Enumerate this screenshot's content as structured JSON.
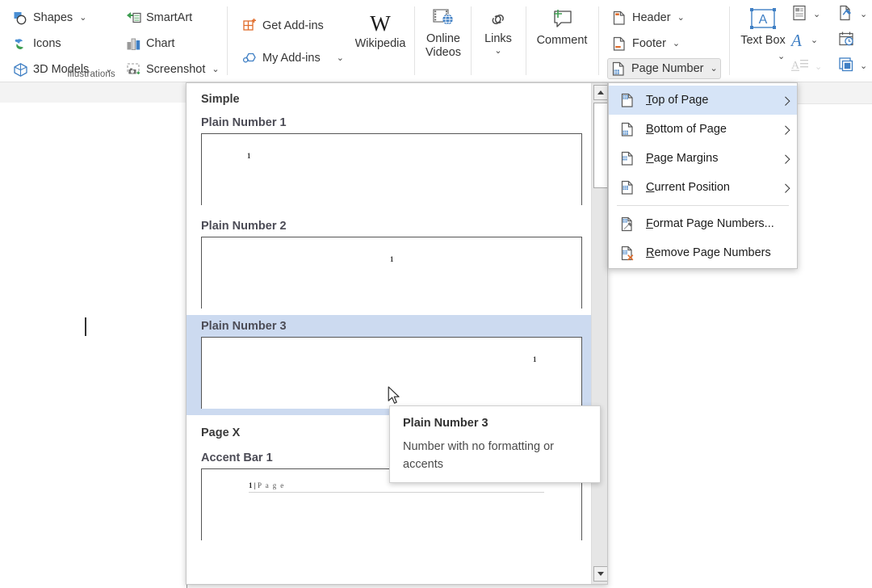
{
  "ribbon": {
    "groups": [
      {
        "name": "illustrations",
        "label": "Illustrations",
        "buttons": [
          {
            "label": "Shapes",
            "icon": "shapes-icon",
            "dropdown": true
          },
          {
            "label": "Icons",
            "icon": "icons-icon",
            "dropdown": false
          },
          {
            "label": "3D Models",
            "icon": "3d-models-icon",
            "dropdown": true
          },
          {
            "label": "SmartArt",
            "icon": "smartart-icon",
            "dropdown": false
          },
          {
            "label": "Chart",
            "icon": "chart-icon",
            "dropdown": false
          },
          {
            "label": "Screenshot",
            "icon": "screenshot-icon",
            "dropdown": true
          }
        ]
      },
      {
        "name": "add-ins",
        "buttons": [
          {
            "label": "Get Add-ins",
            "icon": "get-add-ins-icon",
            "dropdown": false
          },
          {
            "label": "My Add-ins",
            "icon": "my-add-ins-icon",
            "dropdown": true
          }
        ],
        "big": [
          {
            "label": "Wikipedia",
            "icon": "wikipedia-icon"
          }
        ]
      },
      {
        "name": "media",
        "big": [
          {
            "label": "Online Videos",
            "icon": "online-videos-icon"
          }
        ]
      },
      {
        "name": "links",
        "big": [
          {
            "label": "Links",
            "icon": "links-icon",
            "dropdown": true
          }
        ]
      },
      {
        "name": "comments",
        "big": [
          {
            "label": "Comment",
            "icon": "comment-icon"
          }
        ]
      },
      {
        "name": "header-footer",
        "buttons": [
          {
            "label": "Header",
            "icon": "header-icon",
            "dropdown": true
          },
          {
            "label": "Footer",
            "icon": "footer-icon",
            "dropdown": true
          },
          {
            "label": "Page Number",
            "icon": "page-number-icon",
            "dropdown": true,
            "state": "open"
          }
        ]
      },
      {
        "name": "text",
        "label_partial": "ext",
        "big": [
          {
            "label": "Text Box",
            "icon": "text-box-icon",
            "dropdown": true
          }
        ],
        "small_icons": [
          {
            "name": "quick-parts-icon",
            "dropdown": true
          },
          {
            "name": "wordart-icon",
            "dropdown": true
          },
          {
            "name": "drop-cap-icon",
            "dropdown": true,
            "disabled": true
          },
          {
            "name": "signature-line-icon",
            "dropdown": true
          },
          {
            "name": "date-time-icon",
            "dropdown": false
          },
          {
            "name": "object-icon",
            "dropdown": true
          }
        ]
      }
    ]
  },
  "gallery": {
    "name": "page-number-gallery",
    "categories": [
      {
        "heading": "Simple",
        "items": [
          {
            "title": "Plain Number 1",
            "number": "1",
            "align": "left",
            "selected": false
          },
          {
            "title": "Plain Number 2",
            "number": "1",
            "align": "center",
            "selected": false
          },
          {
            "title": "Plain Number 3",
            "number": "1",
            "align": "right",
            "selected": true
          }
        ]
      },
      {
        "heading": "Page X",
        "items": [
          {
            "title": "Accent Bar 1",
            "number": "1",
            "suffix": "P a g e",
            "separator": "|",
            "align": "accent",
            "selected": false
          }
        ]
      }
    ],
    "scrollbar": {
      "up_arrow": "scroll-up-arrow",
      "down_arrow": "scroll-down-arrow",
      "thumb": "scroll-thumb"
    }
  },
  "menu": {
    "name": "page-number-menu",
    "items": [
      {
        "label": "Top of Page",
        "accesskey": "T",
        "icon": "top-of-page-icon",
        "submenu": true,
        "selected": true
      },
      {
        "label": "Bottom of Page",
        "accesskey": "B",
        "icon": "bottom-of-page-icon",
        "submenu": true,
        "selected": false
      },
      {
        "label": "Page Margins",
        "accesskey": "P",
        "icon": "page-margins-icon",
        "submenu": true,
        "selected": false
      },
      {
        "label": "Current Position",
        "accesskey": "C",
        "icon": "current-position-icon",
        "submenu": true,
        "selected": false
      },
      {
        "divider": true
      },
      {
        "label": "Format Page Numbers...",
        "accesskey": "F",
        "icon": "format-page-numbers-icon",
        "submenu": false,
        "selected": false
      },
      {
        "label": "Remove Page Numbers",
        "accesskey": "R",
        "icon": "remove-page-numbers-icon",
        "submenu": false,
        "selected": false
      }
    ]
  },
  "tooltip": {
    "title": "Plain Number 3",
    "description": "Number with no formatting or accents"
  },
  "colors": {
    "menu_highlight": "#d6e4f7",
    "gallery_selection": "#ccdaf0",
    "accent_blue": "#2b7cd3",
    "icon_orange": "#e06c2b",
    "icon_green": "#4aa657",
    "text": "#1b1b1b"
  }
}
